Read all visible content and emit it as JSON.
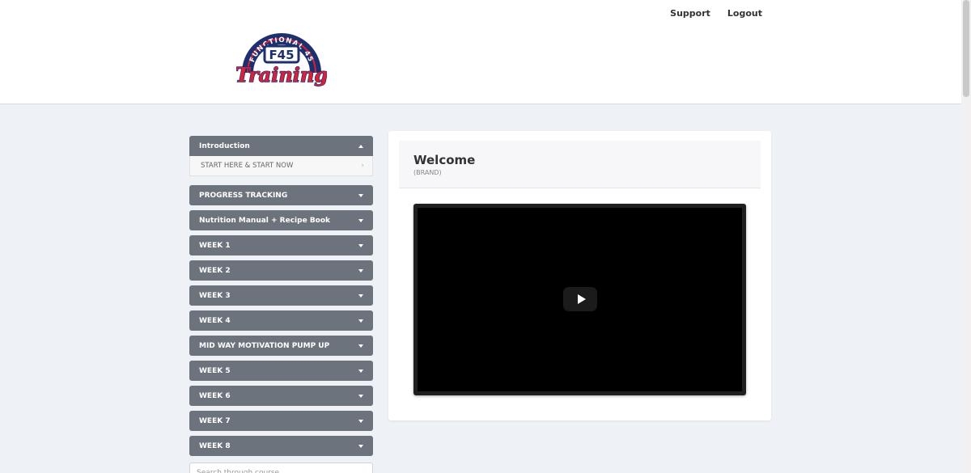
{
  "header": {
    "logo": {
      "top_text": "FUNCTIONAL 45",
      "badge": "F45",
      "script": "Training"
    },
    "links": [
      {
        "label": "Support"
      },
      {
        "label": "Logout"
      }
    ]
  },
  "sidebar": {
    "open_module": {
      "label": "Introduction",
      "lessons": [
        {
          "label": "START HERE & START NOW"
        }
      ]
    },
    "modules": [
      {
        "label": "PROGRESS TRACKING"
      },
      {
        "label": "Nutrition Manual + Recipe Book"
      },
      {
        "label": "WEEK 1"
      },
      {
        "label": "WEEK 2"
      },
      {
        "label": "WEEK 3"
      },
      {
        "label": "WEEK 4"
      },
      {
        "label": "MID WAY MOTIVATION PUMP UP"
      },
      {
        "label": "WEEK 5"
      },
      {
        "label": "WEEK 6"
      },
      {
        "label": "WEEK 7"
      },
      {
        "label": "WEEK 8"
      }
    ],
    "search_placeholder": "Search through course"
  },
  "main": {
    "title": "Welcome",
    "subtitle": "(BRAND)"
  },
  "colors": {
    "module_bg": "#6c737d",
    "page_bg": "#eef2f6",
    "logo_red": "#d6213a",
    "logo_navy": "#1e2f6e"
  }
}
